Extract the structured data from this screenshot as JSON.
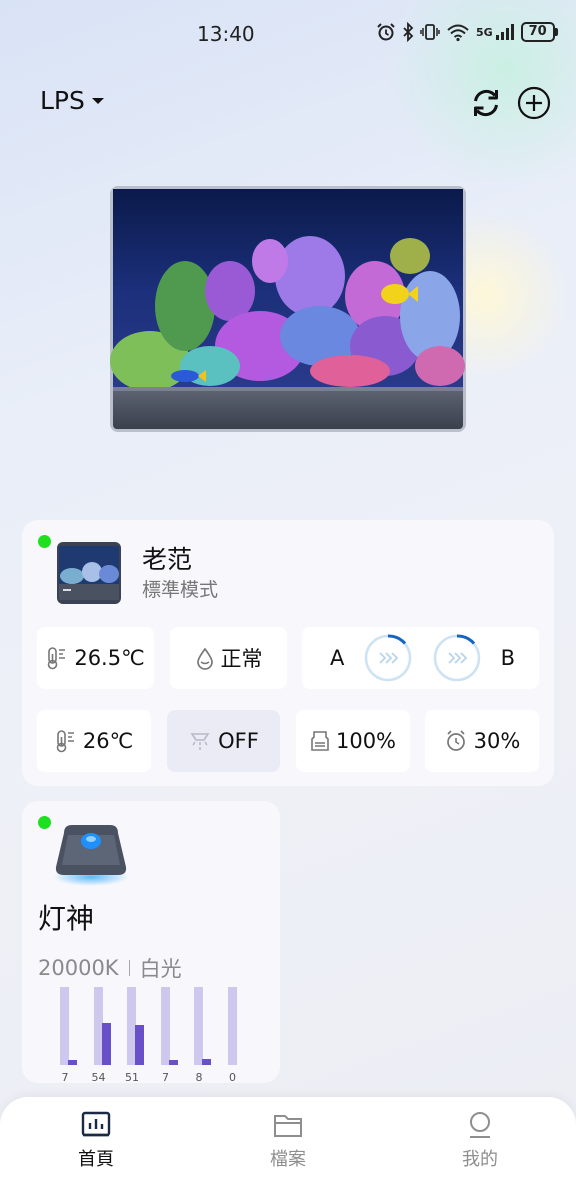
{
  "status_bar": {
    "time": "13:40",
    "network": "5G",
    "battery": "70"
  },
  "header": {
    "tank_name": "LPS"
  },
  "tank_card": {
    "device_name": "老范",
    "mode": "標準模式",
    "online": true,
    "temperature": "26.5℃",
    "water_status": "正常",
    "pump_a_label": "A",
    "pump_b_label": "B",
    "temp_setpoint": "26℃",
    "uv_status": "OFF",
    "level_1": "100%",
    "level_2": "30%"
  },
  "light_card": {
    "device_name": "灯神",
    "online": true,
    "color_temp": "20000K",
    "light_mode": "白光",
    "channels": [
      7,
      54,
      51,
      7,
      8,
      0
    ]
  },
  "bottom_nav": {
    "items": [
      {
        "label": "首頁",
        "icon": "chart-icon",
        "active": true
      },
      {
        "label": "檔案",
        "icon": "folder-icon",
        "active": false
      },
      {
        "label": "我的",
        "icon": "profile-icon",
        "active": false
      }
    ]
  },
  "colors": {
    "accent": "#1565c0",
    "online": "#1ee01e",
    "channel_fill": "#6a50c8",
    "channel_track": "#cfc8ee"
  }
}
